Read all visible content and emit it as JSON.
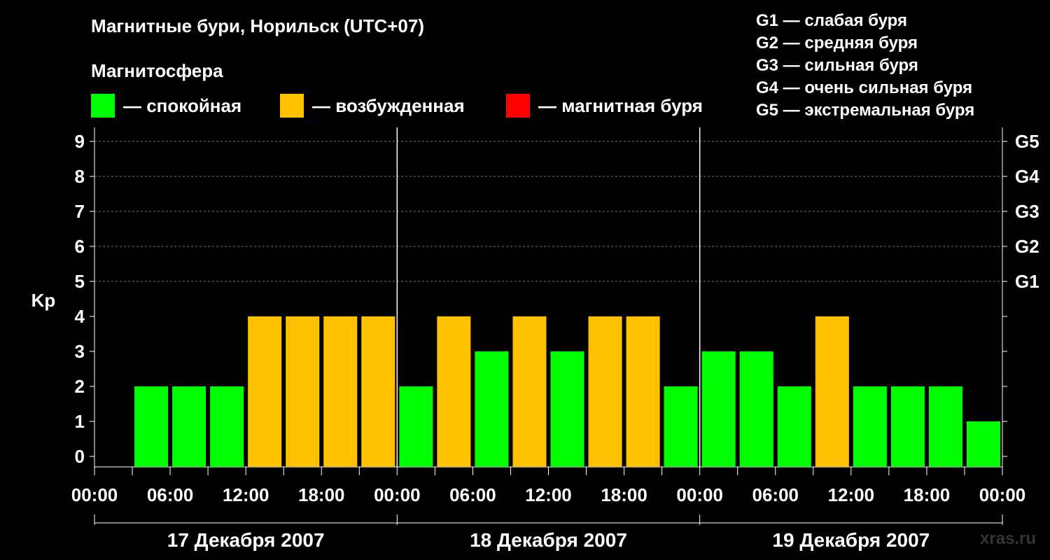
{
  "header": {
    "title": "Магнитные бури, Норильск (UTC+07)",
    "subtitle": "Магнитосфера"
  },
  "legend": [
    {
      "label": "— спокойная",
      "color": "#00ff00"
    },
    {
      "label": "— возбужденная",
      "color": "#ffc000"
    },
    {
      "label": "— магнитная буря",
      "color": "#ff0000"
    }
  ],
  "gscale": [
    "G1 — слабая буря",
    "G2 — средняя буря",
    "G3 — сильная буря",
    "G4 — очень сильная буря",
    "G5 — экстремальная буря"
  ],
  "watermark": "xras.ru",
  "chart_data": {
    "type": "bar",
    "ylabel": "Kp",
    "ylim": [
      0,
      9
    ],
    "yticks": [
      "0",
      "1",
      "2",
      "3",
      "4",
      "5",
      "6",
      "7",
      "8",
      "9"
    ],
    "g_levels": [
      {
        "label": "G1",
        "kp": 5
      },
      {
        "label": "G2",
        "kp": 6
      },
      {
        "label": "G3",
        "kp": 7
      },
      {
        "label": "G4",
        "kp": 8
      },
      {
        "label": "G5",
        "kp": 9
      }
    ],
    "grid": "horizontal dashed at Kp 5–9",
    "xticks": [
      "00:00",
      "06:00",
      "12:00",
      "18:00",
      "00:00",
      "06:00",
      "12:00",
      "18:00",
      "00:00",
      "06:00",
      "12:00",
      "18:00",
      "00:00"
    ],
    "days": [
      "17 Декабря 2007",
      "18 Декабря 2007",
      "19 Декабря 2007"
    ],
    "interval_hours": 3,
    "series": [
      {
        "values": [
          null,
          2,
          2,
          2,
          4,
          4,
          4,
          4,
          2,
          4,
          3,
          4,
          3,
          4,
          4,
          2,
          3,
          3,
          2,
          4,
          2,
          2,
          2,
          1
        ],
        "colors": [
          "",
          "#00ff00",
          "#00ff00",
          "#00ff00",
          "#ffc000",
          "#ffc000",
          "#ffc000",
          "#ffc000",
          "#00ff00",
          "#ffc000",
          "#00ff00",
          "#ffc000",
          "#00ff00",
          "#ffc000",
          "#ffc000",
          "#00ff00",
          "#00ff00",
          "#00ff00",
          "#00ff00",
          "#ffc000",
          "#00ff00",
          "#00ff00",
          "#00ff00",
          "#00ff00"
        ]
      }
    ]
  }
}
